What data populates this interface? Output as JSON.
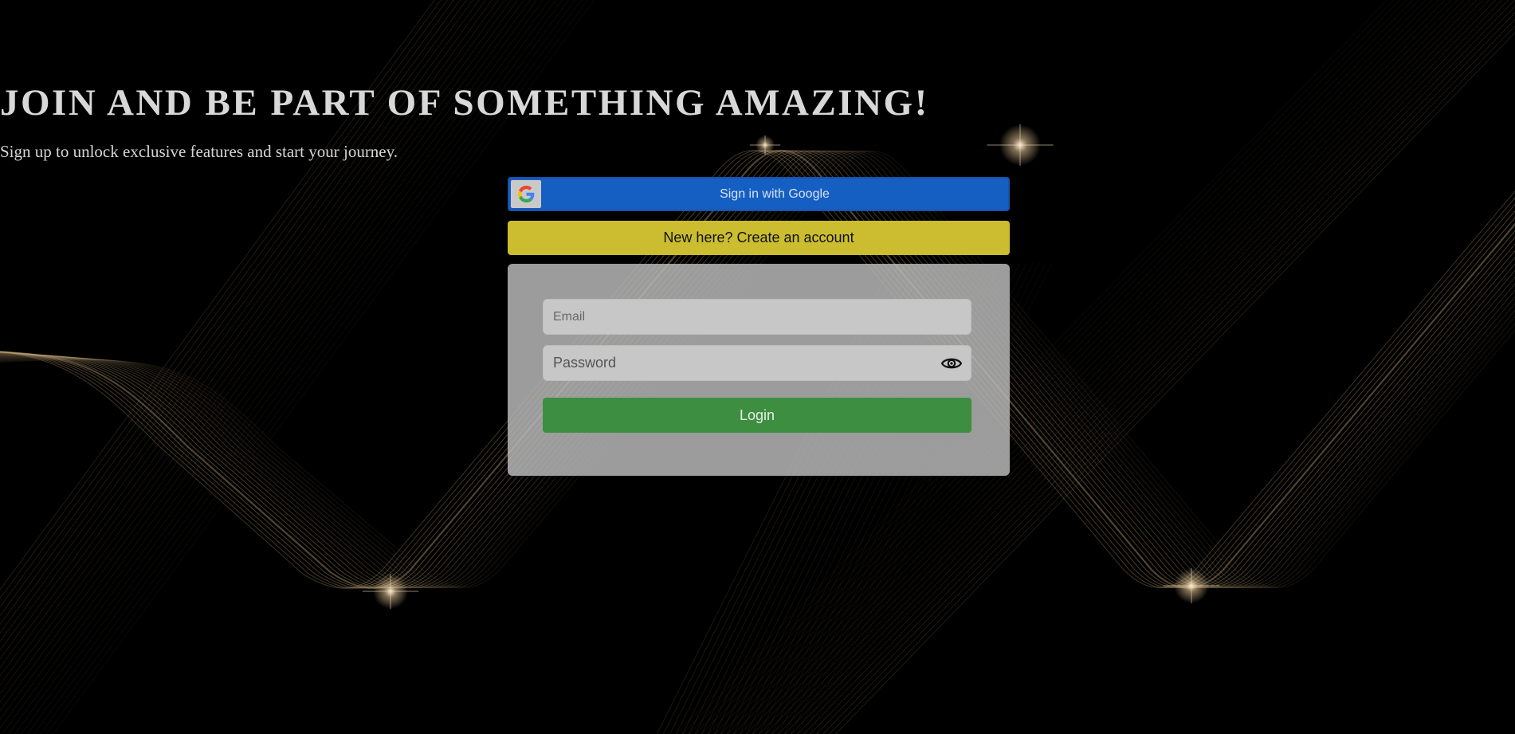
{
  "hero": {
    "title": "JOIN AND BE PART OF SOMETHING AMAZING!",
    "subtitle": "Sign up to unlock exclusive features and start your journey."
  },
  "google_signin": {
    "label": "Sign in with Google",
    "icon": "google-g-icon"
  },
  "create_account": {
    "label": "New here? Create an account"
  },
  "login_form": {
    "email_placeholder": "Email",
    "password_placeholder": "Password",
    "password_toggle_icon": "eye-icon",
    "submit_label": "Login"
  },
  "colors": {
    "background": "#000000",
    "google_button": "#165fc2",
    "create_button": "#cbbd2f",
    "login_button": "#3e8e41",
    "card": "#bebebe",
    "ribbon_gold": "#c8a97a"
  }
}
